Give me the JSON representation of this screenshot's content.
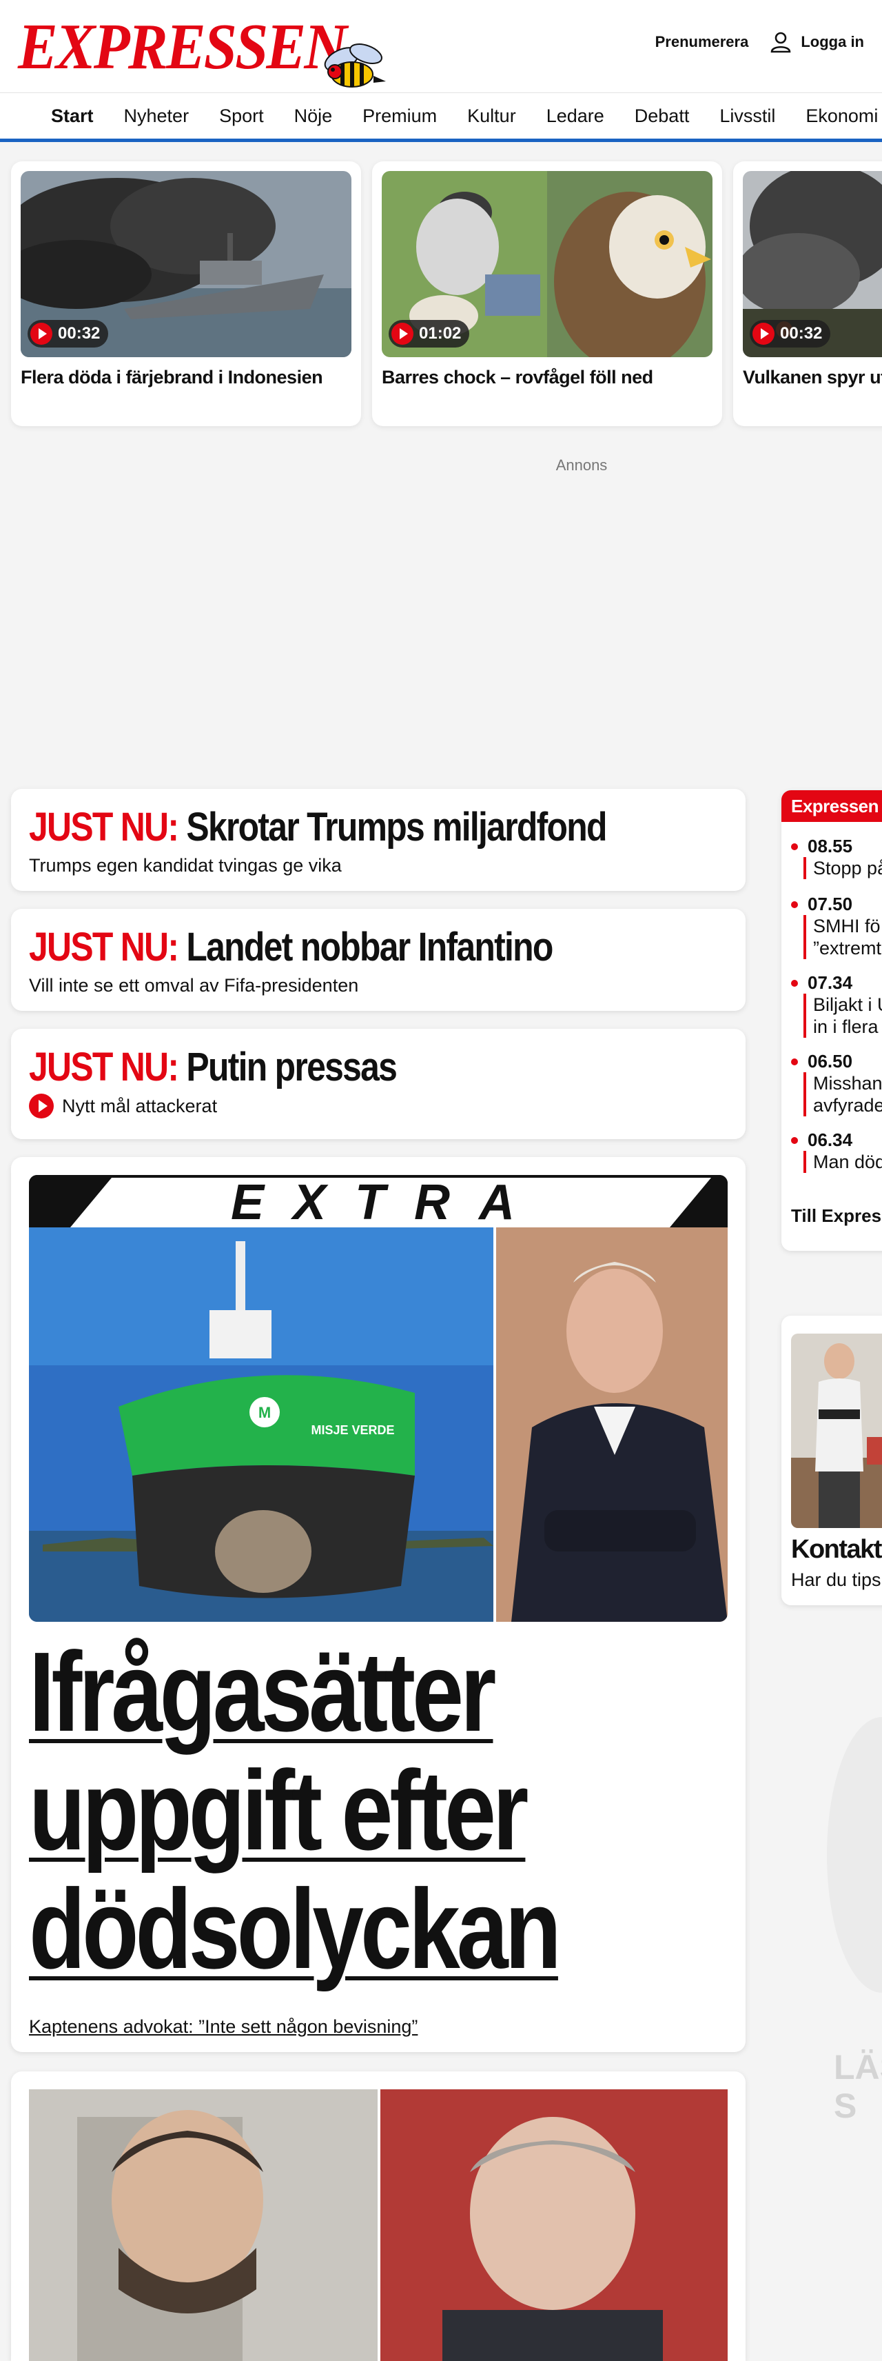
{
  "header": {
    "logo_text": "EXPRESSEN",
    "subscribe_label": "Prenumerera",
    "login_label": "Logga in"
  },
  "nav": {
    "items": [
      {
        "label": "Start",
        "active": true
      },
      {
        "label": "Nyheter",
        "active": false
      },
      {
        "label": "Sport",
        "active": false
      },
      {
        "label": "Nöje",
        "active": false
      },
      {
        "label": "Premium",
        "active": false
      },
      {
        "label": "Kultur",
        "active": false
      },
      {
        "label": "Ledare",
        "active": false
      },
      {
        "label": "Debatt",
        "active": false
      },
      {
        "label": "Livsstil",
        "active": false
      },
      {
        "label": "Ekonomi",
        "active": false
      }
    ]
  },
  "videos": [
    {
      "duration": "00:32",
      "title": "Flera döda i färjebrand i Indonesien"
    },
    {
      "duration": "01:02",
      "title": "Barres chock – rovfågel föll ned"
    },
    {
      "duration": "00:32",
      "title": "Vulkanen spyr ut"
    }
  ],
  "ad": {
    "label": "Annons"
  },
  "just_now": [
    {
      "prefix": "JUST NU:",
      "headline": "Skrotar Trumps miljardfond",
      "sub": "Trumps egen kandidat tvingas ge vika",
      "has_video": false
    },
    {
      "prefix": "JUST NU:",
      "headline": "Landet nobbar Infantino",
      "sub": "Vill inte se ett omval av Fifa-presidenten",
      "has_video": false
    },
    {
      "prefix": "JUST NU:",
      "headline": "Putin pressas",
      "sub": "Nytt mål attackerat",
      "has_video": true
    }
  ],
  "extra": {
    "banner": "EXTRA",
    "headline": "Ifrågasätter uppgift efter dödsolyckan",
    "sub": "Kaptenens advokat: ”Inte sett någon bevisning”",
    "ship_label": "MISJE VERDE"
  },
  "side_live": {
    "title": "Expressen",
    "items": [
      {
        "time": "08.55",
        "text": "Stopp på"
      },
      {
        "time": "07.50",
        "text": "SMHI fö\n”extremt"
      },
      {
        "time": "07.34",
        "text": "Biljakt i U\nin i flera"
      },
      {
        "time": "06.50",
        "text": "Misshan\navfyrade"
      },
      {
        "time": "06.34",
        "text": "Man död"
      }
    ],
    "more_label": "Till Express"
  },
  "side_contact": {
    "title": "Kontakta",
    "sub": "Har du tips"
  },
  "side_faded": {
    "text": "LÄS\nS"
  },
  "colors": {
    "brand_red": "#e30613",
    "nav_blue": "#1a63c2",
    "background": "#f4f4f4"
  }
}
